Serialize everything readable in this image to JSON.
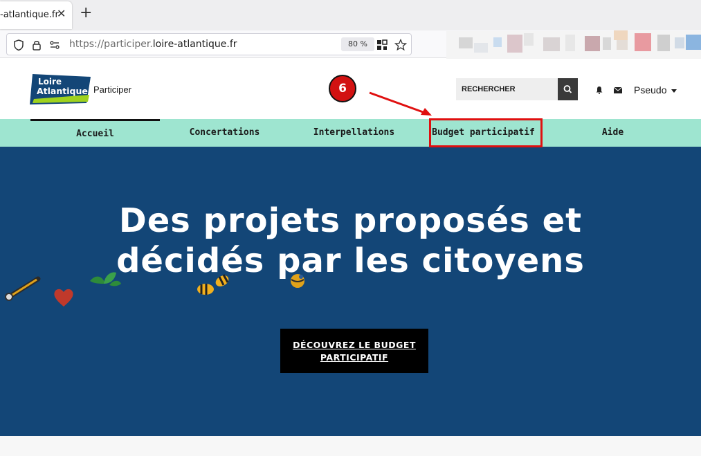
{
  "browser": {
    "tab_title": "-atlantique.fr",
    "url_scheme": "https://participer.",
    "url_domain": "loire-atlantique.fr",
    "zoom": "80 %"
  },
  "header": {
    "logo_line1": "Loire",
    "logo_line2": "Atlantique",
    "logo_subtitle": "Participer",
    "search_placeholder": "RECHERCHER",
    "user_name": "Pseudo"
  },
  "annotation": {
    "step": "6"
  },
  "nav": {
    "items": [
      {
        "label": "Accueil"
      },
      {
        "label": "Concertations"
      },
      {
        "label": "Interpellations"
      },
      {
        "label": "Budget participatif"
      },
      {
        "label": "Aide"
      }
    ]
  },
  "hero": {
    "title_line1": "Des projets proposés et",
    "title_line2": "décidés par les citoyens",
    "cta_line1": "DÉCOUVREZ LE BUDGET",
    "cta_line2": "PARTICIPATIF"
  },
  "colors": {
    "nav_bg": "#9ee5d0",
    "hero_bg": "#134677",
    "annotation_red": "#e01010",
    "logo_blue": "#134677",
    "logo_green": "#9fd21d"
  }
}
